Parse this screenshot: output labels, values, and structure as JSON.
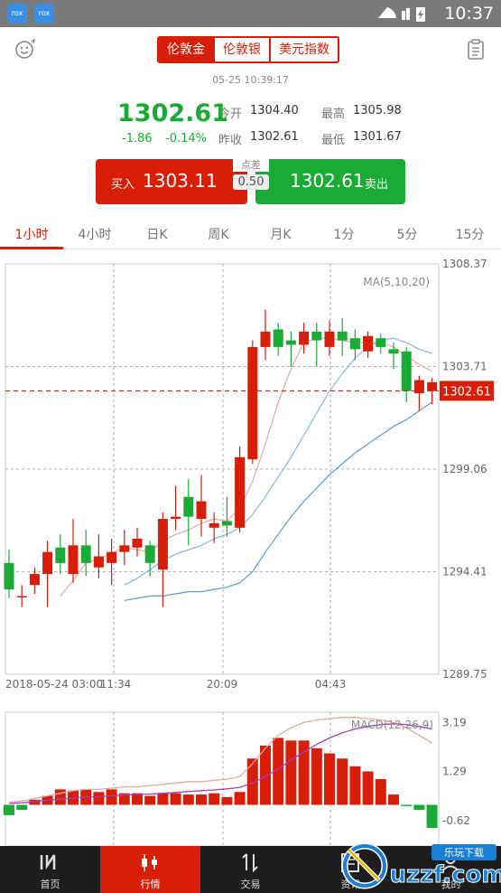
{
  "status_bar": {
    "time": "10:37",
    "app_icon_text": "rox"
  },
  "header": {
    "instrument_tabs": [
      "伦敦金",
      "伦敦银",
      "美元指数"
    ],
    "timestamp": "05-25 10:39:17"
  },
  "quote": {
    "price": "1302.61",
    "change": "-1.86",
    "change_pct": "-0.14%",
    "open_label": "今开",
    "open": "1304.40",
    "high_label": "最高",
    "high": "1305.98",
    "prev_close_label": "昨收",
    "prev_close": "1302.61",
    "low_label": "最低",
    "low": "1301.67",
    "buy_label": "买入",
    "buy_price": "1303.11",
    "sell_label": "卖出",
    "sell_price": "1302.61",
    "spread_label": "点差",
    "spread": "0.50"
  },
  "period_tabs": [
    "1小时",
    "4小时",
    "日K",
    "周K",
    "月K",
    "1分",
    "5分",
    "15分"
  ],
  "colors": {
    "up": "#d81e06",
    "down": "#1aaa36",
    "ma5": "#e0a9a0",
    "ma10": "#8ab4e0",
    "ma20": "#5b9bd5",
    "dif": "#e0a9a0",
    "dea": "#a040c0"
  },
  "chart_data": [
    {
      "type": "candlestick",
      "legend": "MA(5,10,20)",
      "ylim": [
        1289.75,
        1308.37
      ],
      "y_ticks": [
        "1308.37",
        "1303.71",
        "1299.06",
        "1294.41",
        "1289.75"
      ],
      "x_ticks": [
        "2018-05-24 03:00",
        "11:34",
        "20:09",
        "04:43"
      ],
      "current_price_label": "1302.61",
      "current_price": 1302.61,
      "candles": [
        {
          "o": 1294.8,
          "c": 1293.6,
          "h": 1295.4,
          "l": 1293.2
        },
        {
          "o": 1293.3,
          "c": 1293.3,
          "h": 1293.8,
          "l": 1292.8
        },
        {
          "o": 1293.8,
          "c": 1294.3,
          "h": 1294.6,
          "l": 1293.4
        },
        {
          "o": 1294.3,
          "c": 1295.3,
          "h": 1295.8,
          "l": 1292.8
        },
        {
          "o": 1295.5,
          "c": 1294.8,
          "h": 1296.1,
          "l": 1294.3
        },
        {
          "o": 1294.3,
          "c": 1295.6,
          "h": 1296.8,
          "l": 1293.9
        },
        {
          "o": 1295.6,
          "c": 1294.8,
          "h": 1296.3,
          "l": 1294.2
        },
        {
          "o": 1294.6,
          "c": 1295.1,
          "h": 1296.1,
          "l": 1294.1
        },
        {
          "o": 1294.8,
          "c": 1295.3,
          "h": 1295.9,
          "l": 1293.8
        },
        {
          "o": 1295.3,
          "c": 1295.6,
          "h": 1296.3,
          "l": 1294.7
        },
        {
          "o": 1295.5,
          "c": 1295.9,
          "h": 1296.4,
          "l": 1295.1
        },
        {
          "o": 1295.6,
          "c": 1294.8,
          "h": 1295.8,
          "l": 1294.2
        },
        {
          "o": 1294.5,
          "c": 1296.8,
          "h": 1297.1,
          "l": 1292.8
        },
        {
          "o": 1296.8,
          "c": 1296.9,
          "h": 1298.3,
          "l": 1296.3
        },
        {
          "o": 1297.8,
          "c": 1296.9,
          "h": 1298.6,
          "l": 1295.6
        },
        {
          "o": 1296.8,
          "c": 1297.6,
          "h": 1298.8,
          "l": 1296.0
        },
        {
          "o": 1296.4,
          "c": 1296.6,
          "h": 1297.1,
          "l": 1295.7
        },
        {
          "o": 1296.7,
          "c": 1296.5,
          "h": 1297.8,
          "l": 1296.0
        },
        {
          "o": 1296.4,
          "c": 1299.6,
          "h": 1300.1,
          "l": 1296.2
        },
        {
          "o": 1299.5,
          "c": 1304.6,
          "h": 1304.9,
          "l": 1299.3
        },
        {
          "o": 1304.6,
          "c": 1305.3,
          "h": 1306.3,
          "l": 1304.0
        },
        {
          "o": 1305.4,
          "c": 1304.6,
          "h": 1305.7,
          "l": 1304.2
        },
        {
          "o": 1304.9,
          "c": 1304.7,
          "h": 1305.3,
          "l": 1303.7
        },
        {
          "o": 1304.7,
          "c": 1305.3,
          "h": 1305.7,
          "l": 1304.3
        },
        {
          "o": 1305.3,
          "c": 1304.9,
          "h": 1305.7,
          "l": 1303.7
        },
        {
          "o": 1304.6,
          "c": 1305.3,
          "h": 1305.8,
          "l": 1304.2
        },
        {
          "o": 1305.3,
          "c": 1304.9,
          "h": 1305.9,
          "l": 1304.2
        },
        {
          "o": 1305.0,
          "c": 1304.5,
          "h": 1305.4,
          "l": 1304.0
        },
        {
          "o": 1304.4,
          "c": 1305.1,
          "h": 1305.3,
          "l": 1304.1
        },
        {
          "o": 1305.0,
          "c": 1304.6,
          "h": 1305.2,
          "l": 1304.3
        },
        {
          "o": 1304.5,
          "c": 1304.3,
          "h": 1304.8,
          "l": 1303.6
        },
        {
          "o": 1304.4,
          "c": 1302.6,
          "h": 1304.6,
          "l": 1302.1
        },
        {
          "o": 1302.5,
          "c": 1303.1,
          "h": 1303.3,
          "l": 1301.7
        },
        {
          "o": 1302.6,
          "c": 1303.0,
          "h": 1303.2,
          "l": 1302.0
        }
      ],
      "ma5": [
        null,
        null,
        null,
        null,
        1293.3,
        1294.0,
        1294.8,
        1295.0,
        1295.2,
        1295.5,
        1295.4,
        1295.3,
        1295.8,
        1296.1,
        1296.3,
        1296.6,
        1296.8,
        1296.7,
        1297.3,
        1298.5,
        1300.2,
        1302.1,
        1303.6,
        1304.8,
        1305.0,
        1305.0,
        1304.9,
        1304.8,
        1304.8,
        1304.8,
        1304.6,
        1304.2,
        1303.8,
        1303.5
      ],
      "ma10": [
        null,
        null,
        null,
        null,
        null,
        null,
        null,
        null,
        null,
        1293.8,
        1294.1,
        1294.5,
        1294.9,
        1295.2,
        1295.4,
        1295.6,
        1295.9,
        1296.1,
        1296.4,
        1297.0,
        1297.8,
        1298.7,
        1299.6,
        1300.6,
        1301.6,
        1302.6,
        1303.4,
        1304.1,
        1304.6,
        1304.9,
        1305.0,
        1304.8,
        1304.5,
        1304.3
      ],
      "ma20": [
        null,
        null,
        null,
        null,
        null,
        null,
        null,
        null,
        null,
        1293.1,
        1293.2,
        1293.3,
        1293.3,
        1293.4,
        1293.5,
        1293.5,
        1293.6,
        1293.7,
        1293.9,
        1294.4,
        1295.3,
        1296.1,
        1296.9,
        1297.6,
        1298.2,
        1298.8,
        1299.3,
        1299.8,
        1300.2,
        1300.6,
        1301.0,
        1301.3,
        1301.7,
        1302.1
      ]
    },
    {
      "type": "bar",
      "legend": "MACD(12,26,9)",
      "ylim": [
        -1.6,
        3.6
      ],
      "y_ticks": [
        "3.19",
        "1.29",
        "-0.62"
      ],
      "macd": [
        -0.4,
        -0.2,
        0.2,
        0.35,
        0.6,
        0.55,
        0.6,
        0.5,
        0.6,
        0.45,
        0.45,
        0.35,
        0.45,
        0.45,
        0.4,
        0.4,
        0.45,
        0.3,
        0.5,
        1.8,
        2.3,
        2.6,
        2.5,
        2.5,
        2.2,
        2.0,
        1.8,
        1.5,
        1.3,
        1.0,
        0.4,
        -0.05,
        -0.2,
        -0.9
      ],
      "dif": [
        0.1,
        0.15,
        0.25,
        0.35,
        0.45,
        0.55,
        0.6,
        0.6,
        0.65,
        0.7,
        0.7,
        0.75,
        0.8,
        0.85,
        0.9,
        0.9,
        0.95,
        1.0,
        1.1,
        1.6,
        2.2,
        2.7,
        3.0,
        3.2,
        3.3,
        3.35,
        3.4,
        3.4,
        3.35,
        3.3,
        3.2,
        3.0,
        2.7,
        2.4
      ],
      "dea": [
        0.05,
        0.08,
        0.12,
        0.18,
        0.22,
        0.26,
        0.3,
        0.32,
        0.35,
        0.38,
        0.4,
        0.42,
        0.45,
        0.48,
        0.52,
        0.55,
        0.58,
        0.62,
        0.68,
        0.85,
        1.1,
        1.4,
        1.75,
        2.05,
        2.35,
        2.6,
        2.8,
        2.95,
        3.05,
        3.12,
        3.15,
        3.12,
        3.05,
        2.95
      ]
    }
  ],
  "bottom_nav": [
    "首页",
    "行情",
    "交易",
    "资讯",
    "我的"
  ],
  "watermark": {
    "text": "uzzf.com",
    "badge": "乐玩下载"
  }
}
